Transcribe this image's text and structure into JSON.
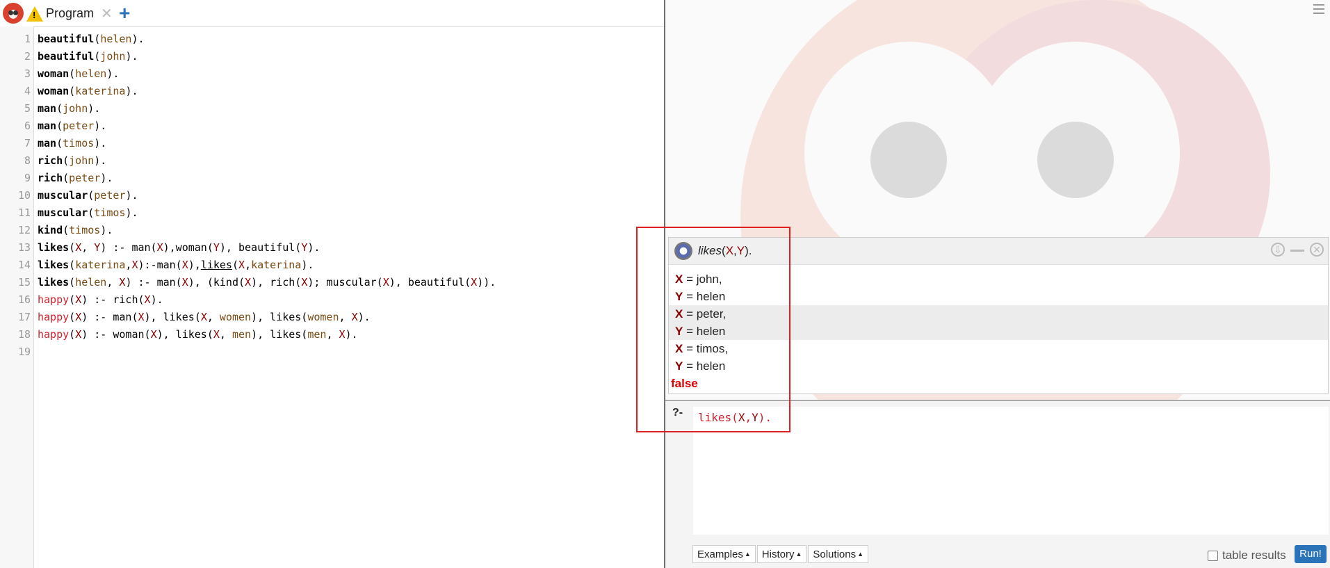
{
  "tab": {
    "label": "Program",
    "close": "✕",
    "add": "+"
  },
  "code": [
    {
      "n": "1",
      "parts": [
        [
          "kw",
          "beautiful"
        ],
        [
          "p",
          "("
        ],
        [
          "atom",
          "helen"
        ],
        [
          "p",
          ")."
        ]
      ]
    },
    {
      "n": "2",
      "parts": [
        [
          "kw",
          "beautiful"
        ],
        [
          "p",
          "("
        ],
        [
          "atom",
          "john"
        ],
        [
          "p",
          ")."
        ]
      ]
    },
    {
      "n": "3",
      "parts": [
        [
          "kw",
          "woman"
        ],
        [
          "p",
          "("
        ],
        [
          "atom",
          "helen"
        ],
        [
          "p",
          ")."
        ]
      ]
    },
    {
      "n": "4",
      "parts": [
        [
          "kw",
          "woman"
        ],
        [
          "p",
          "("
        ],
        [
          "atom",
          "katerina"
        ],
        [
          "p",
          ")."
        ]
      ]
    },
    {
      "n": "5",
      "parts": [
        [
          "kw",
          "man"
        ],
        [
          "p",
          "("
        ],
        [
          "atom",
          "john"
        ],
        [
          "p",
          ")."
        ]
      ]
    },
    {
      "n": "6",
      "parts": [
        [
          "kw",
          "man"
        ],
        [
          "p",
          "("
        ],
        [
          "atom",
          "peter"
        ],
        [
          "p",
          ")."
        ]
      ]
    },
    {
      "n": "7",
      "parts": [
        [
          "kw",
          "man"
        ],
        [
          "p",
          "("
        ],
        [
          "atom",
          "timos"
        ],
        [
          "p",
          ")."
        ]
      ]
    },
    {
      "n": "8",
      "parts": [
        [
          "kw",
          "rich"
        ],
        [
          "p",
          "("
        ],
        [
          "atom",
          "john"
        ],
        [
          "p",
          ")."
        ]
      ]
    },
    {
      "n": "9",
      "parts": [
        [
          "kw",
          "rich"
        ],
        [
          "p",
          "("
        ],
        [
          "atom",
          "peter"
        ],
        [
          "p",
          ")."
        ]
      ]
    },
    {
      "n": "10",
      "parts": [
        [
          "kw",
          "muscular"
        ],
        [
          "p",
          "("
        ],
        [
          "atom",
          "peter"
        ],
        [
          "p",
          ")."
        ]
      ]
    },
    {
      "n": "11",
      "parts": [
        [
          "kw",
          "muscular"
        ],
        [
          "p",
          "("
        ],
        [
          "atom",
          "timos"
        ],
        [
          "p",
          ")."
        ]
      ]
    },
    {
      "n": "12",
      "parts": [
        [
          "kw",
          "kind"
        ],
        [
          "p",
          "("
        ],
        [
          "atom",
          "timos"
        ],
        [
          "p",
          ")."
        ]
      ]
    },
    {
      "n": "13",
      "parts": [
        [
          "kw",
          "likes"
        ],
        [
          "p",
          "("
        ],
        [
          "var",
          "X"
        ],
        [
          "p",
          ", "
        ],
        [
          "var",
          "Y"
        ],
        [
          "p",
          ") :- man("
        ],
        [
          "var",
          "X"
        ],
        [
          "p",
          "),woman("
        ],
        [
          "var",
          "Y"
        ],
        [
          "p",
          "), beautiful("
        ],
        [
          "var",
          "Y"
        ],
        [
          "p",
          ")."
        ]
      ]
    },
    {
      "n": "14",
      "parts": [
        [
          "kw",
          "likes"
        ],
        [
          "p",
          "("
        ],
        [
          "atom",
          "katerina"
        ],
        [
          "p",
          ","
        ],
        [
          "var",
          "X"
        ],
        [
          "p",
          "):-man("
        ],
        [
          "var",
          "X"
        ],
        [
          "p",
          "),"
        ],
        [
          "ul",
          "likes"
        ],
        [
          "p",
          "("
        ],
        [
          "var",
          "X"
        ],
        [
          "p",
          ","
        ],
        [
          "atom",
          "katerina"
        ],
        [
          "p",
          ")."
        ]
      ]
    },
    {
      "n": "15",
      "parts": [
        [
          "kw",
          "likes"
        ],
        [
          "p",
          "("
        ],
        [
          "atom",
          "helen"
        ],
        [
          "p",
          ", "
        ],
        [
          "var",
          "X"
        ],
        [
          "p",
          ") :- man("
        ],
        [
          "var",
          "X"
        ],
        [
          "p",
          "), (kind("
        ],
        [
          "var",
          "X"
        ],
        [
          "p",
          "), rich("
        ],
        [
          "var",
          "X"
        ],
        [
          "p",
          "); muscular("
        ],
        [
          "var",
          "X"
        ],
        [
          "p",
          "), beautiful("
        ],
        [
          "var",
          "X"
        ],
        [
          "p",
          "))."
        ]
      ]
    },
    {
      "n": "16",
      "parts": [
        [
          "red",
          "happy"
        ],
        [
          "p",
          "("
        ],
        [
          "var",
          "X"
        ],
        [
          "p",
          ") :- rich("
        ],
        [
          "var",
          "X"
        ],
        [
          "p",
          ")."
        ]
      ]
    },
    {
      "n": "17",
      "parts": [
        [
          "red",
          "happy"
        ],
        [
          "p",
          "("
        ],
        [
          "var",
          "X"
        ],
        [
          "p",
          ") :- man("
        ],
        [
          "var",
          "X"
        ],
        [
          "p",
          "), likes("
        ],
        [
          "var",
          "X"
        ],
        [
          "p",
          ", "
        ],
        [
          "atom",
          "women"
        ],
        [
          "p",
          "), likes("
        ],
        [
          "atom",
          "women"
        ],
        [
          "p",
          ", "
        ],
        [
          "var",
          "X"
        ],
        [
          "p",
          ")."
        ]
      ]
    },
    {
      "n": "18",
      "parts": [
        [
          "red",
          "happy"
        ],
        [
          "p",
          "("
        ],
        [
          "var",
          "X"
        ],
        [
          "p",
          ") :- woman("
        ],
        [
          "var",
          "X"
        ],
        [
          "p",
          "), likes("
        ],
        [
          "var",
          "X"
        ],
        [
          "p",
          ", "
        ],
        [
          "atom",
          "men"
        ],
        [
          "p",
          "), likes("
        ],
        [
          "atom",
          "men"
        ],
        [
          "p",
          ", "
        ],
        [
          "var",
          "X"
        ],
        [
          "p",
          ")."
        ]
      ]
    },
    {
      "n": "19",
      "parts": []
    }
  ],
  "answer": {
    "query_pred": "likes",
    "query_args": "(X,Y).",
    "rows": [
      {
        "var": "X",
        "text": " = john,",
        "sel": false
      },
      {
        "var": "Y",
        "text": " = helen",
        "sel": false
      },
      {
        "var": "X",
        "text": " = peter,",
        "sel": true
      },
      {
        "var": "Y",
        "text": " = helen",
        "sel": true
      },
      {
        "var": "X",
        "text": " = timos,",
        "sel": false
      },
      {
        "var": "Y",
        "text": " = helen",
        "sel": false
      }
    ],
    "result": "false"
  },
  "query": {
    "prompt": "?-",
    "text": "likes(X,Y)."
  },
  "buttons": {
    "examples": "Examples",
    "history": "History",
    "solutions": "Solutions",
    "tri": "▲"
  },
  "table_results": "table results",
  "run": "Run!",
  "colors": {
    "accent": "#2a73b8",
    "highlight": "#e02020",
    "error": "#e00000"
  }
}
